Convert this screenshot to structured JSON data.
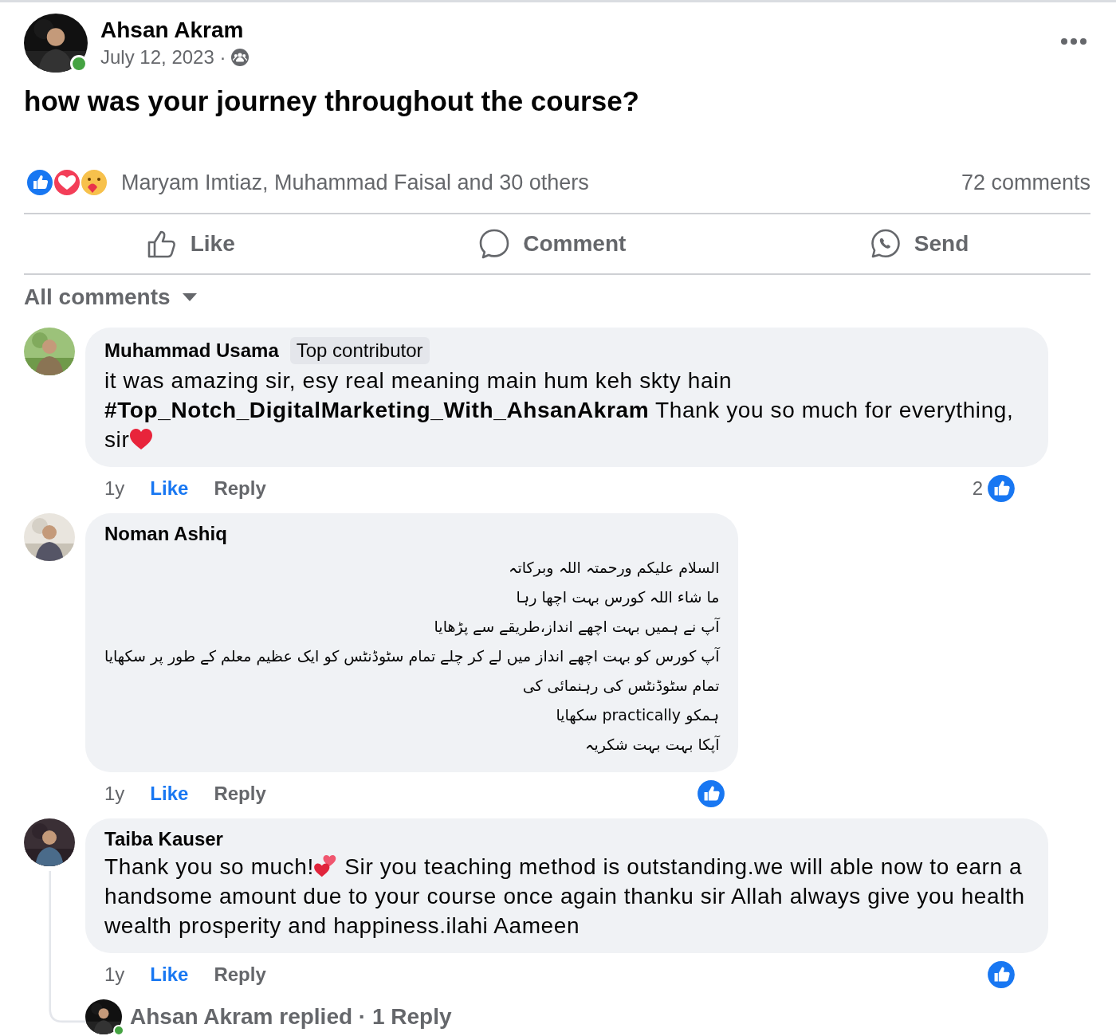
{
  "post": {
    "author": "Ahsan Akram",
    "online": true,
    "date": "July 12, 2023 ·",
    "text": "how was your journey throughout the course?",
    "reactions_text": "Maryam Imtiaz, Muhammad Faisal and 30 others",
    "comments_count": "72 comments"
  },
  "actions": [
    {
      "kind": "like",
      "label": "Like"
    },
    {
      "kind": "comment",
      "label": "Comment"
    },
    {
      "kind": "send",
      "label": "Send"
    }
  ],
  "filter": {
    "label": "All comments"
  },
  "comments": [
    {
      "author": "Muhammad Usama",
      "badge": "Top contributor",
      "segments": [
        {
          "kind": "text",
          "text": "it was amazing sir, esy real meaning main hum keh skty hain **#Top_Notch_DigitalMarketing_With_AhsanAkram** Thank you so much for everything, sir"
        },
        {
          "kind": "heart"
        }
      ],
      "time": "1y",
      "like": "Like",
      "reply": "Reply",
      "reaction_count": "2"
    },
    {
      "author": "Noman Ashiq",
      "lines": [
        "السلام علیکم ورحمتہ اللہ وبرکاتہ",
        "ما شاء اللہ کورس بہت اچھا رہا",
        "آپ نے ہمیں بہت اچھے انداز،طریقے سے پڑھایا",
        "آپ کورس کو بہت اچھے انداز میں لے کر چلے تمام سٹوڈنٹس کو ایک عظیم معلم کے طور پر سکھایا",
        "تمام سٹوڈنٹس کی رہنمائی کی",
        "ہمکو practically سکھایا",
        "آپکا بہت بہت شکریہ"
      ],
      "time": "1y",
      "like": "Like",
      "reply": "Reply"
    },
    {
      "author": "Taiba Kauser",
      "segments": [
        {
          "kind": "text",
          "text": "Thank you so much!"
        },
        {
          "kind": "two-hearts"
        },
        {
          "kind": "text",
          "text": " Sir you teaching method is outstanding.we will able now to earn a handsome amount due to your course once again thanku sir Allah always give you health wealth prosperity and happiness.ilahi Aameen"
        }
      ],
      "time": "1y",
      "like": "Like",
      "reply": "Reply",
      "replies": {
        "text": "Ahsan Akram replied · 1 Reply",
        "online": true
      }
    }
  ]
}
